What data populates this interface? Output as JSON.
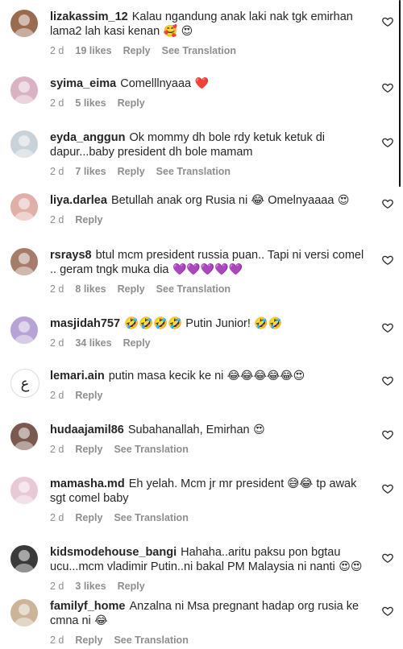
{
  "comments": [
    {
      "username": "lizakassim_12",
      "text": "Kalau ngandung anak laki nak tgk emirhan lama2 lah kasi kenan",
      "emoji": "🥰 😍",
      "time": "2 d",
      "likes": "19 likes",
      "reply": "Reply",
      "translate": "See Translation"
    },
    {
      "username": "syima_eima",
      "text": "Comelllnyaaa",
      "emoji": "❤️",
      "time": "2 d",
      "likes": "5 likes",
      "reply": "Reply",
      "translate": ""
    },
    {
      "username": "eyda_anggun",
      "text": "Ok mommy dh bole rdy ketuk ketuk di dapur...baby president dh bole mamam",
      "emoji": "",
      "time": "2 d",
      "likes": "7 likes",
      "reply": "Reply",
      "translate": "See Translation"
    },
    {
      "username": "liya.darlea",
      "text": "Betullah anak org Rusia ni 😂 Omelnyaaaa",
      "emoji": "😍",
      "time": "2 d",
      "likes": "",
      "reply": "Reply",
      "translate": ""
    },
    {
      "username": "rsrays8",
      "text": "btul mcm president russia puan.. Tapi ni versi comel .. geram tngk muka dia",
      "emoji": "💜💜💜💜💜",
      "time": "2 d",
      "likes": "8 likes",
      "reply": "Reply",
      "translate": "See Translation"
    },
    {
      "username": "masjidah757",
      "text": "🤣🤣🤣🤣 Putin Junior!",
      "emoji": "🤣🤣",
      "time": "2 d",
      "likes": "34 likes",
      "reply": "Reply",
      "translate": ""
    },
    {
      "username": "lemari.ain",
      "text": "putin masa kecik ke ni",
      "emoji": "😂😂😂😂😂😍",
      "time": "2 d",
      "likes": "",
      "reply": "Reply",
      "translate": ""
    },
    {
      "username": "hudaajamil86",
      "text": "Subahanallah, Emirhan",
      "emoji": "😍",
      "time": "2 d",
      "likes": "",
      "reply": "Reply",
      "translate": "See Translation"
    },
    {
      "username": "mamasha.md",
      "text": "Eh yelah. Mcm jr mr president 😅😂 tp awak sgt comel baby",
      "emoji": "",
      "time": "2 d",
      "likes": "",
      "reply": "Reply",
      "translate": "See Translation"
    },
    {
      "username": "kidsmodehouse_bangi",
      "text": "Hahaha..aritu paksu pon bgtau ucu...mcm vladimir Putin..ni bakal PM Malaysia ni nanti",
      "emoji": "😍😍",
      "time": "2 d",
      "likes": "3 likes",
      "reply": "Reply",
      "translate": ""
    },
    {
      "username": "familyf_home",
      "text": "Anzalna ni Msa pregnant hadap org rusia ke cmna ni",
      "emoji": "😂",
      "time": "2 d",
      "likes": "",
      "reply": "Reply",
      "translate": "See Translation"
    }
  ],
  "avatar_colors": [
    "#9a6b4f",
    "#d9b3c4",
    "#c9d1d9",
    "#e0b0a8",
    "#a67c6a",
    "#b7a3d6",
    "#ffffff",
    "#7a5a50",
    "#e8c9d6",
    "#3a3a3a",
    "#cbb49a"
  ]
}
